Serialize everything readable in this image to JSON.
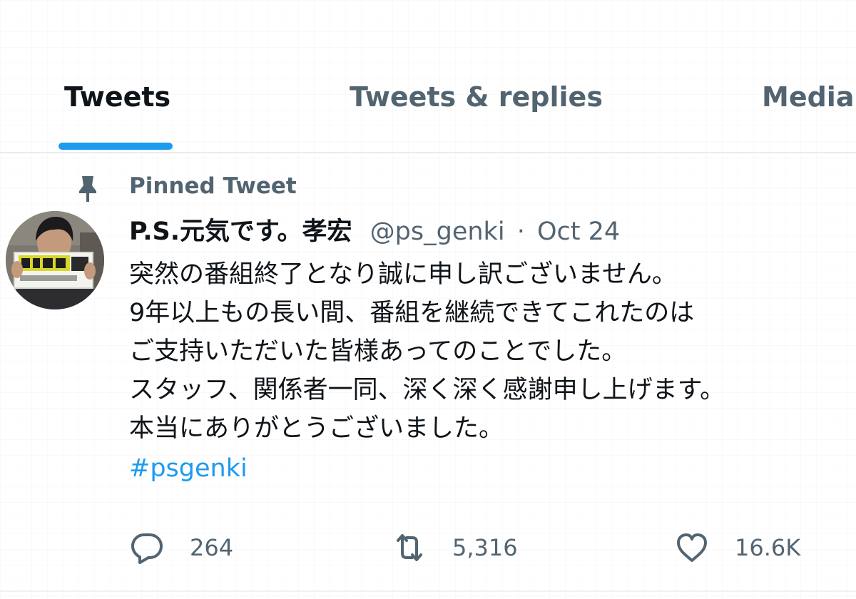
{
  "tabs": [
    {
      "label": "Tweets",
      "selected": true
    },
    {
      "label": "Tweets & replies",
      "selected": false
    },
    {
      "label": "Media",
      "selected": false
    }
  ],
  "colors": {
    "accent": "#1d9bf0",
    "text_primary": "#0f1419",
    "text_secondary": "#536471"
  },
  "pinned": {
    "icon": "pin-icon",
    "label": "Pinned Tweet"
  },
  "tweet": {
    "avatar_icon": "avatar-photo",
    "display_name": "P.S.元気です。孝宏",
    "handle": "@ps_genki",
    "separator": "·",
    "date": "Oct 24",
    "lines": [
      "突然の番組終了となり誠に申し訳ございません。",
      "9年以上もの長い間、番組を継続できてこれたのは",
      "ご支持いただいた皆様あってのことでした。",
      "スタッフ、関係者一同、深く深く感謝申し上げます。",
      "本当にありがとうございました。"
    ],
    "hashtag": "#psgenki",
    "actions": {
      "reply": {
        "icon": "reply-icon",
        "count": "264"
      },
      "retweet": {
        "icon": "retweet-icon",
        "count": "5,316"
      },
      "like": {
        "icon": "heart-icon",
        "count": "16.6K"
      }
    }
  }
}
